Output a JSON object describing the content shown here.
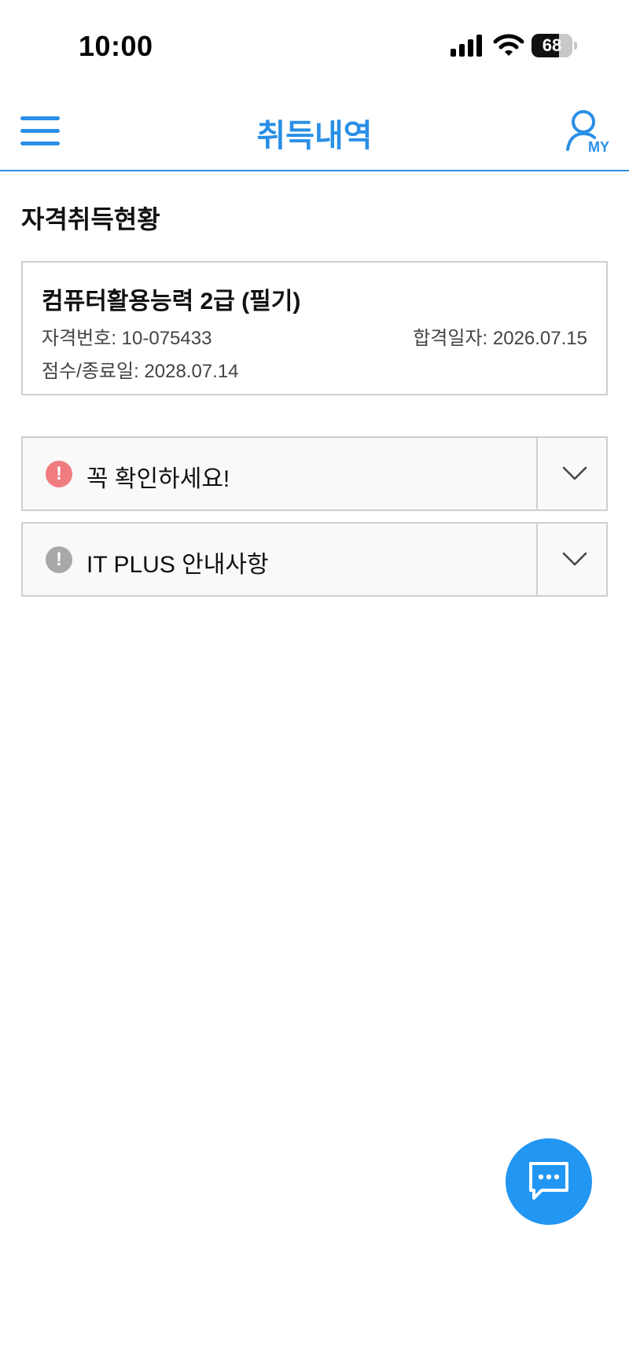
{
  "status_bar": {
    "time": "10:00",
    "battery_level": "68",
    "icons": [
      "signal-icon",
      "wifi-icon",
      "battery-icon"
    ]
  },
  "header": {
    "title": "취득내역",
    "menu_icon": "hamburger-menu-icon",
    "my_icon": "user-my-icon",
    "my_label": "MY",
    "accent_color": "#2a8fe6"
  },
  "section": {
    "title": "자격취득현황"
  },
  "certificate": {
    "name": "컴퓨터활용능력 2급 (필기)",
    "number_text": "자격번호: 10-075433",
    "pass_date_text": "합격일자: 2026.07.15",
    "expiry_text": "점수/종료일: 2028.07.14"
  },
  "notices": [
    {
      "label": "꼭 확인하세요!",
      "icon": "alert-icon",
      "icon_color": "#f07c80"
    },
    {
      "label": "IT PLUS 안내사항",
      "icon": "alert-icon",
      "icon_color": "#a8a8a8"
    }
  ],
  "chat_button": {
    "icon": "chat-bubble-icon",
    "color": "#2196f3"
  }
}
